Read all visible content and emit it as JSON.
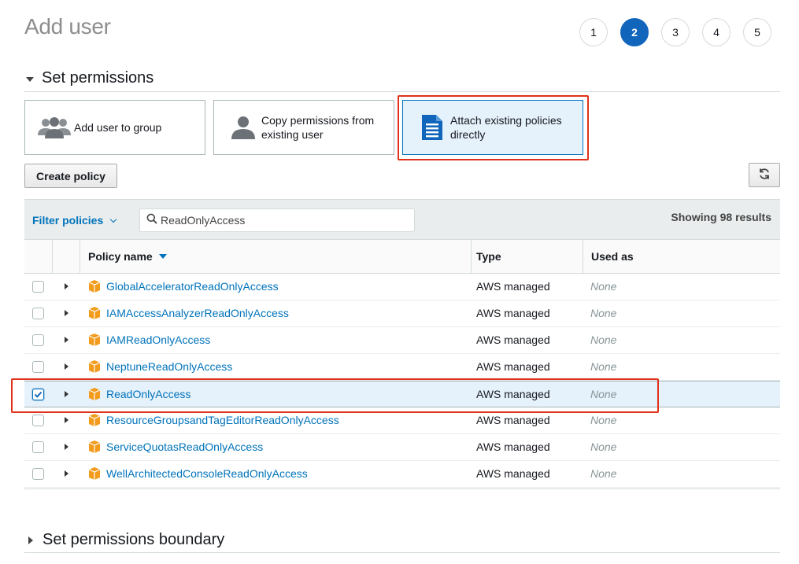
{
  "page_title": "Add user",
  "steps": [
    "1",
    "2",
    "3",
    "4",
    "5"
  ],
  "active_step": "2",
  "sections": {
    "permissions": "Set permissions",
    "boundary": "Set permissions boundary"
  },
  "options": [
    {
      "label": "Add user to group",
      "icon": "group-icon",
      "selected": false
    },
    {
      "label": "Copy permissions from existing user",
      "icon": "user-icon",
      "selected": false
    },
    {
      "label": "Attach existing policies directly",
      "icon": "document-icon",
      "selected": true
    }
  ],
  "toolbar": {
    "create_policy": "Create policy",
    "refresh_icon": "refresh-icon"
  },
  "filter": {
    "label": "Filter policies",
    "search_value": "ReadOnlyAccess",
    "results": "Showing 98 results"
  },
  "table": {
    "columns": {
      "name": "Policy name",
      "type": "Type",
      "used": "Used as"
    },
    "rows": [
      {
        "name": "GlobalAcceleratorReadOnlyAccess",
        "type": "AWS managed",
        "used": "None",
        "checked": false
      },
      {
        "name": "IAMAccessAnalyzerReadOnlyAccess",
        "type": "AWS managed",
        "used": "None",
        "checked": false
      },
      {
        "name": "IAMReadOnlyAccess",
        "type": "AWS managed",
        "used": "None",
        "checked": false
      },
      {
        "name": "NeptuneReadOnlyAccess",
        "type": "AWS managed",
        "used": "None",
        "checked": false
      },
      {
        "name": "ReadOnlyAccess",
        "type": "AWS managed",
        "used": "None",
        "checked": true
      },
      {
        "name": "ResourceGroupsandTagEditorReadOnlyAccess",
        "type": "AWS managed",
        "used": "None",
        "checked": false
      },
      {
        "name": "ServiceQuotasReadOnlyAccess",
        "type": "AWS managed",
        "used": "None",
        "checked": false
      },
      {
        "name": "WellArchitectedConsoleReadOnlyAccess",
        "type": "AWS managed",
        "used": "None",
        "checked": false
      }
    ]
  },
  "colors": {
    "accent": "#0073bb",
    "step_active": "#1166bb",
    "highlight": "#e0321a",
    "policy_icon": "#f29b1d"
  }
}
